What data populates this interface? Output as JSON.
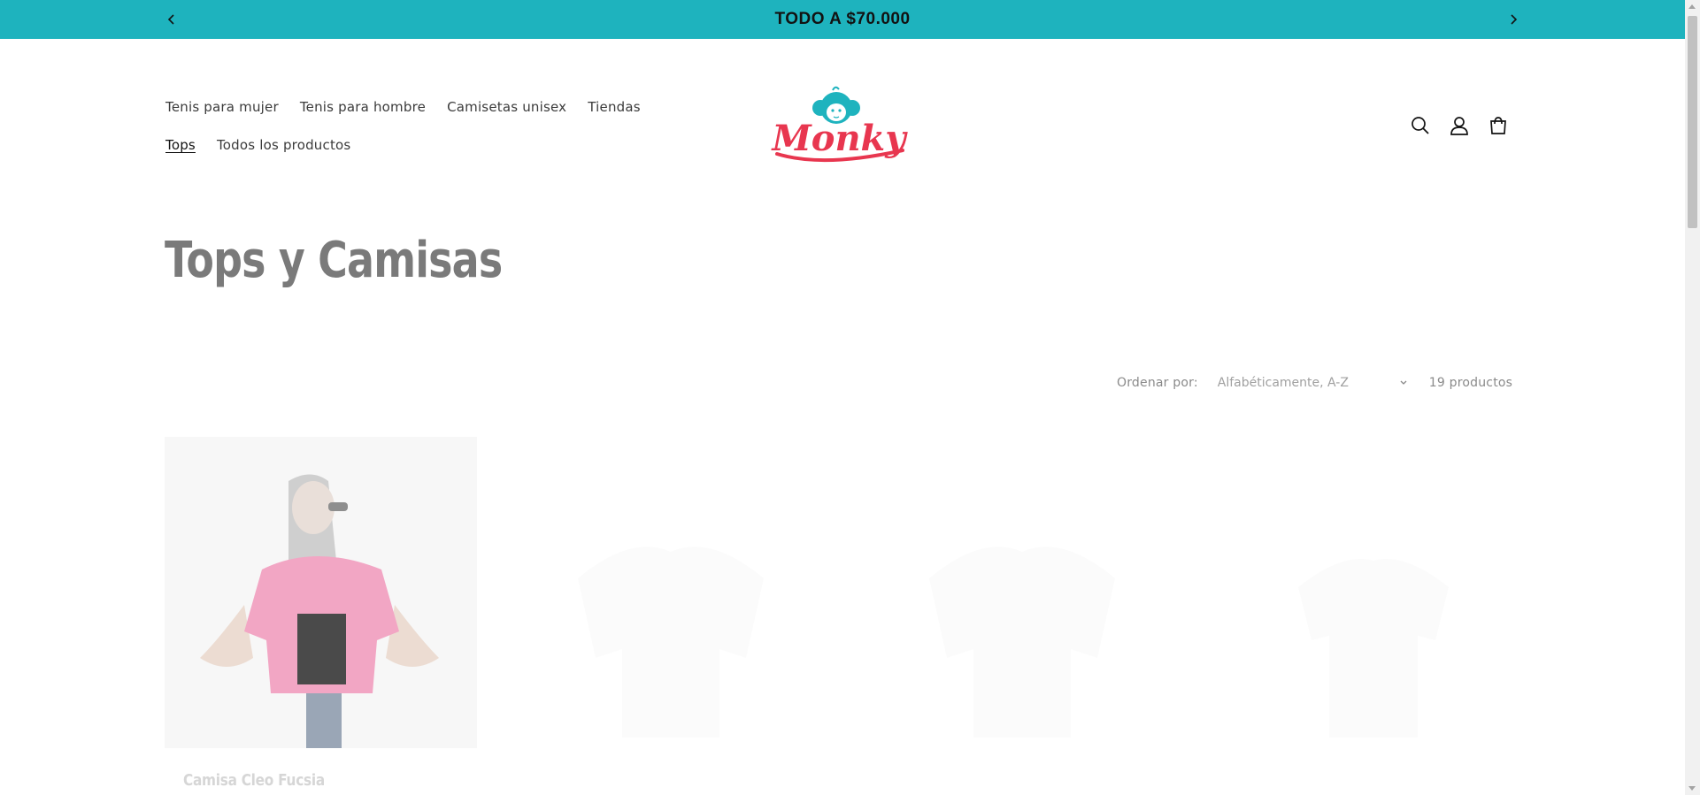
{
  "announcement": {
    "message": "TODO A $70.000",
    "prev_icon": "chevron-left-icon",
    "next_icon": "chevron-right-icon",
    "background": "#1eb3be"
  },
  "nav": {
    "items": [
      {
        "label": "Tenis para mujer"
      },
      {
        "label": "Tenis para hombre"
      },
      {
        "label": "Camisetas unisex"
      },
      {
        "label": "Tiendas"
      },
      {
        "label": "Tops",
        "active": true
      },
      {
        "label": "Todos los productos"
      }
    ]
  },
  "logo": {
    "text": "Monky",
    "primary_color": "#e8364f",
    "mascot_color": "#1eb3be"
  },
  "header_icons": [
    "search-icon",
    "account-icon",
    "cart-icon"
  ],
  "page": {
    "title": "Tops y Camisas"
  },
  "sort": {
    "label": "Ordenar por:",
    "selected": "Alfabéticamente, A-Z",
    "count": "19 productos"
  },
  "products": [
    {
      "title": "Camisa Cleo Fucsia",
      "color": "#f2a6c4"
    }
  ]
}
